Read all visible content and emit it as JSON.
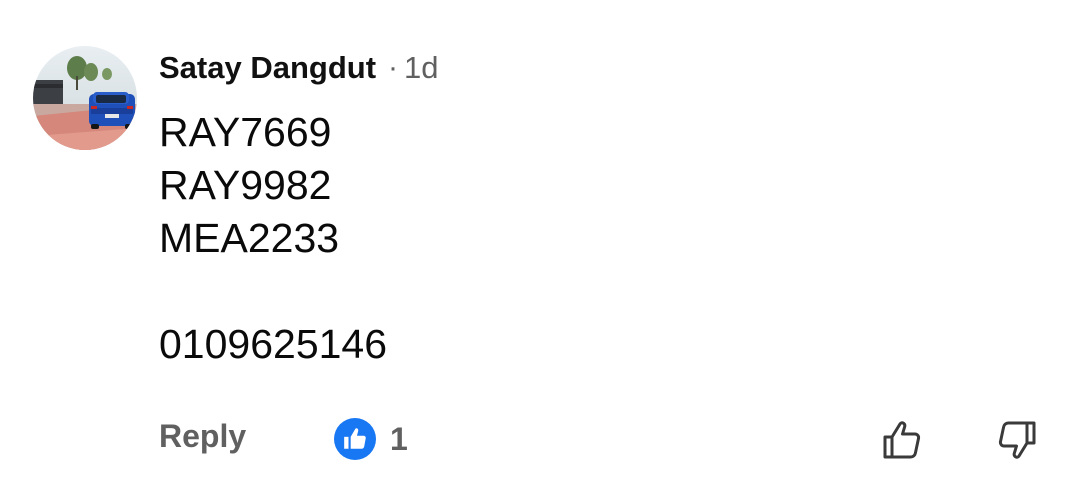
{
  "comment": {
    "author": "Satay Dangdut",
    "separator": "·",
    "timestamp": "1d",
    "lines": [
      "RAY7669",
      "RAY9982",
      "MEA2233",
      "",
      "0109625146"
    ],
    "avatar_icon": "profile-photo-blue-car",
    "actions": {
      "reply_label": "Reply",
      "like_count": "1",
      "like_badge_icon": "thumbs-up-icon",
      "like_button_icon": "thumbs-up-outline-icon",
      "dislike_button_icon": "thumbs-down-outline-icon"
    },
    "colors": {
      "secondary_text": "#606060",
      "like_badge": "#1877f2"
    }
  }
}
